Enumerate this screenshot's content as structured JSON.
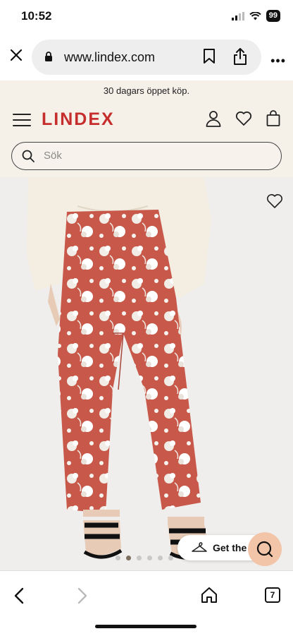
{
  "status": {
    "time": "10:52",
    "battery": "99"
  },
  "browser": {
    "url": "www.lindex.com",
    "tab_count": "7"
  },
  "promo": {
    "text": "30 dagars öppet köp."
  },
  "header": {
    "logo": "LINDEX"
  },
  "search": {
    "placeholder": "Sök"
  },
  "product": {
    "get_look_label": "Get the l",
    "gallery_dots": 6,
    "active_dot": 2
  },
  "colors": {
    "brand": "#c62e2e",
    "pants": "#c8594a",
    "chat_bubble": "#f3c5a8"
  }
}
